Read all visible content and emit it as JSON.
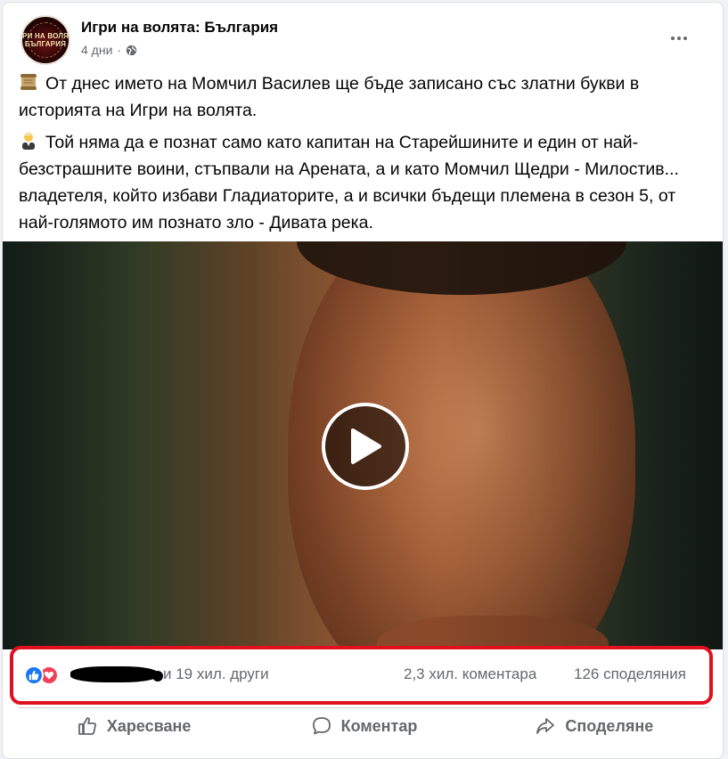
{
  "post": {
    "page_name": "Игри на волята: България",
    "time": "4 дни",
    "separator": "·",
    "avatar_logo_line1": "ИГРИ НА ВОЛЯТА",
    "avatar_logo_line2": "БЪЛГАРИЯ",
    "paragraphs": [
      {
        "emoji": "scroll",
        "text": "От днес името на Момчил Василев ще бъде записано със златни букви в историята на Игри на волята."
      },
      {
        "emoji": "man-judge",
        "text": "Той няма да е познат само като капитан на Старейшините и един от най-безстрашните воини, стъпвали на Арената, а и като Момчил Щедри - Милостив... владетеля, който избави Гладиаторите, а и всички бъдещи племена в сезон 5, от най-голямото им познато зло - Дивата река."
      }
    ],
    "media": {
      "type": "video",
      "play_icon": "play-icon"
    }
  },
  "stats": {
    "reactions": [
      "like-icon",
      "love-icon"
    ],
    "reaction_count_suffix": "и 19 хил. други",
    "comments": "2,3 хил. коментара",
    "shares": "126 споделяния"
  },
  "actions": {
    "like_label": "Харесване",
    "comment_label": "Коментар",
    "share_label": "Споделяне"
  },
  "colors": {
    "highlight": "#e0101e",
    "like": "#1877f2",
    "love": "#f33e58",
    "secondary_text": "#65676b"
  }
}
